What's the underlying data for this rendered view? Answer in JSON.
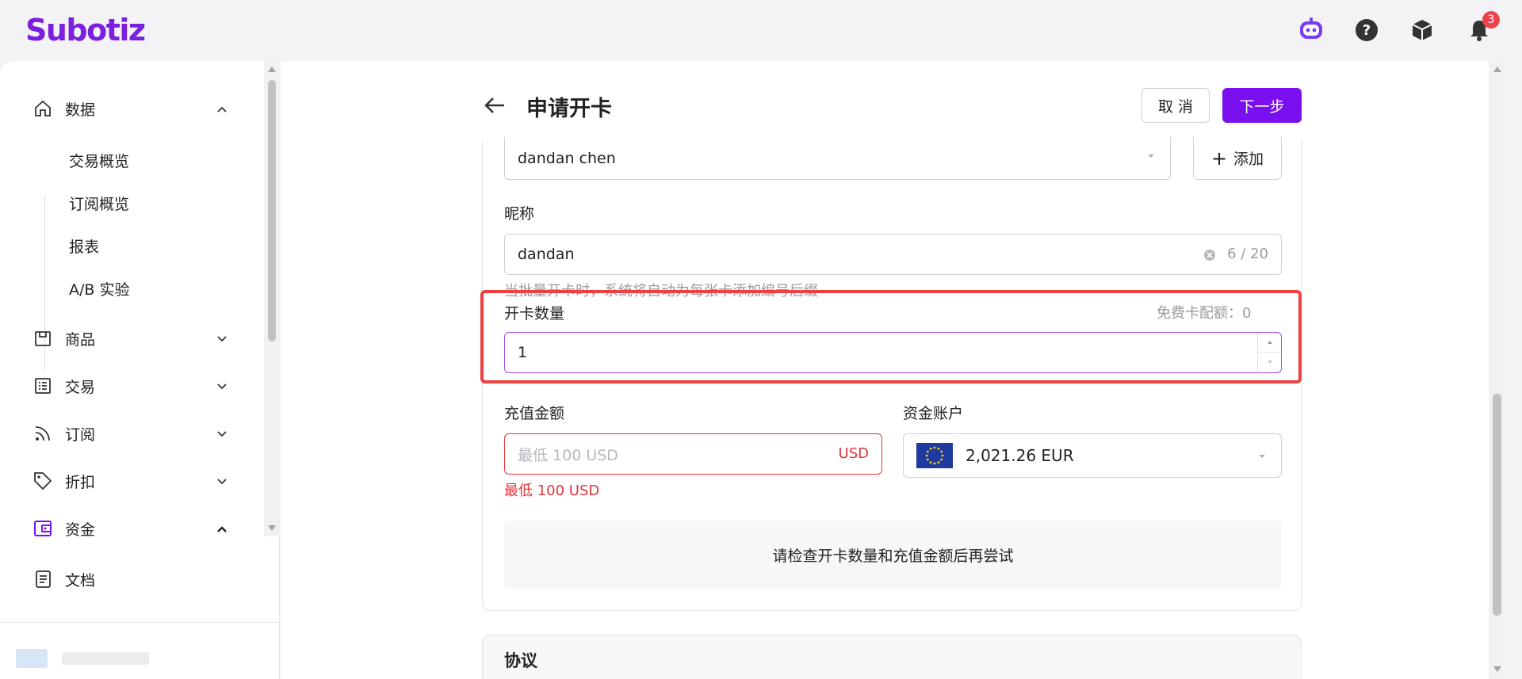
{
  "app": {
    "logo": "Subotiz"
  },
  "header": {
    "notifications_count": "3"
  },
  "sidebar": {
    "items": [
      {
        "label": "数据",
        "icon": "home-icon",
        "expanded": true
      },
      {
        "label": "商品",
        "icon": "box-icon",
        "expanded": false
      },
      {
        "label": "交易",
        "icon": "list-icon",
        "expanded": false
      },
      {
        "label": "订阅",
        "icon": "rss-icon",
        "expanded": false
      },
      {
        "label": "折扣",
        "icon": "tag-icon",
        "expanded": false
      },
      {
        "label": "资金",
        "icon": "wallet-icon",
        "expanded": true
      },
      {
        "label": "文档",
        "icon": "doc-icon"
      }
    ],
    "sub_items": [
      "交易概览",
      "订阅概览",
      "报表",
      "A/B 实验"
    ]
  },
  "page": {
    "title": "申请开卡",
    "cancel_label": "取 消",
    "next_label": "下一步"
  },
  "form": {
    "cardholder_value": "dandan chen",
    "add_label": "添加",
    "nickname_label": "昵称",
    "nickname_value": "dandan",
    "nickname_count": "6 / 20",
    "nickname_hint": "当批量开卡时，系统将自动为每张卡添加编号后缀",
    "quantity_label": "开卡数量",
    "free_quota": "免费卡配额：0",
    "quantity_value": "1",
    "topup_label": "充值金额",
    "topup_placeholder": "最低 100 USD",
    "topup_suffix": "USD",
    "topup_error": "最低 100 USD",
    "account_label": "资金账户",
    "account_value": "2,021.26 EUR",
    "notice": "请检查开卡数量和充值金额后再尝试"
  },
  "agreement": {
    "title": "协议"
  },
  "colors": {
    "brand": "#7a0ff0",
    "danger": "#e5343d",
    "highlight": "#ef3f3f"
  }
}
